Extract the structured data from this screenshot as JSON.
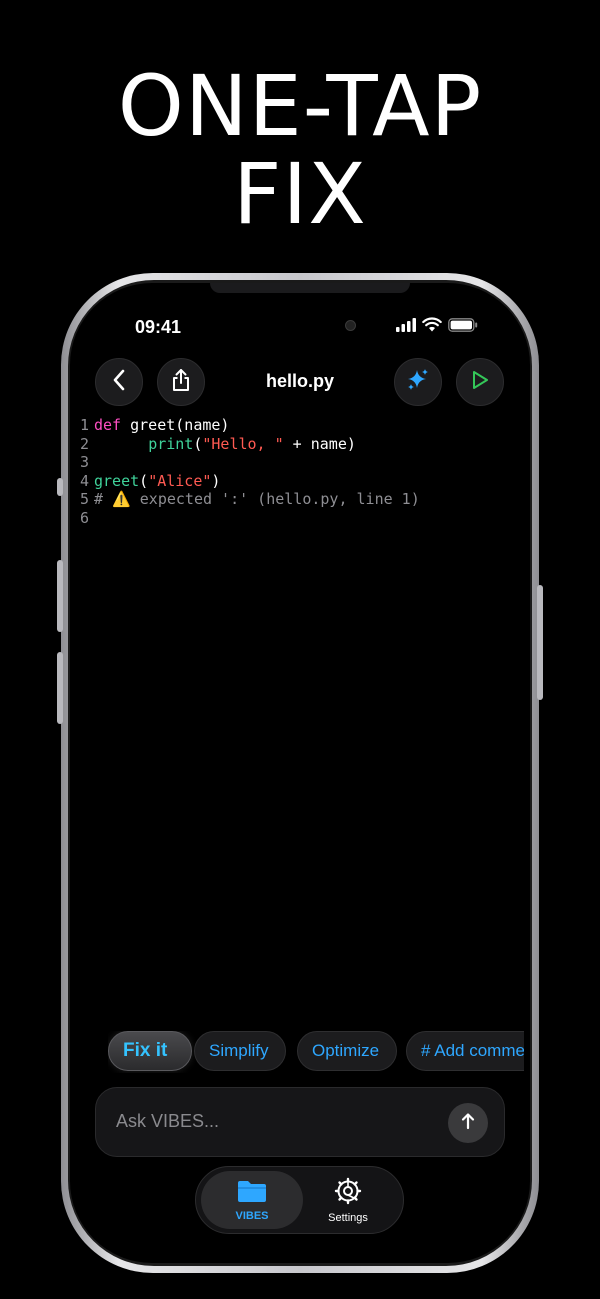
{
  "headline": {
    "line1": "ONE-TAP",
    "line2": "FIX"
  },
  "status_bar": {
    "time": "09:41",
    "icons": [
      "signal-icon",
      "wifi-icon",
      "battery-icon"
    ]
  },
  "toolbar": {
    "title": "hello.py",
    "back_icon": "chevron-left-icon",
    "share_icon": "share-icon",
    "ai_icon": "sparkles-icon",
    "run_icon": "play-icon"
  },
  "editor": {
    "lines": [
      {
        "num": "1",
        "tokens": [
          {
            "t": "def",
            "k": "kw"
          },
          {
            "t": " greet(name)",
            "k": "fn"
          }
        ]
      },
      {
        "num": "2",
        "tokens": [
          {
            "t": "      ",
            "k": "plain"
          },
          {
            "t": "print",
            "k": "call"
          },
          {
            "t": "(",
            "k": "plain"
          },
          {
            "t": "\"Hello, \"",
            "k": "str"
          },
          {
            "t": " + name)",
            "k": "plain"
          }
        ]
      },
      {
        "num": "3",
        "tokens": []
      },
      {
        "num": "4",
        "tokens": [
          {
            "t": "greet",
            "k": "call"
          },
          {
            "t": "(",
            "k": "plain"
          },
          {
            "t": "\"Alice\"",
            "k": "str"
          },
          {
            "t": ")",
            "k": "plain"
          }
        ]
      },
      {
        "num": "5",
        "tokens": [
          {
            "t": "# ⚠️ expected ':' (hello.py, line 1)",
            "k": "cmt"
          }
        ]
      },
      {
        "num": "6",
        "tokens": []
      }
    ]
  },
  "chips": [
    {
      "label": "Fix it",
      "active": true
    },
    {
      "label": "Simplify",
      "active": false
    },
    {
      "label": "Optimize",
      "active": false
    },
    {
      "label": "# Add comments",
      "active": false
    }
  ],
  "ask": {
    "placeholder": "Ask VIBES..."
  },
  "tabs": [
    {
      "label": "VIBES",
      "icon": "folder-icon",
      "active": true
    },
    {
      "label": "Settings",
      "icon": "gear-icon",
      "active": false
    }
  ],
  "colors": {
    "accent": "#2ea7ff",
    "run": "#34c759",
    "keyword": "#ff4fc3",
    "string": "#ff5a52",
    "call": "#3fd29a"
  }
}
